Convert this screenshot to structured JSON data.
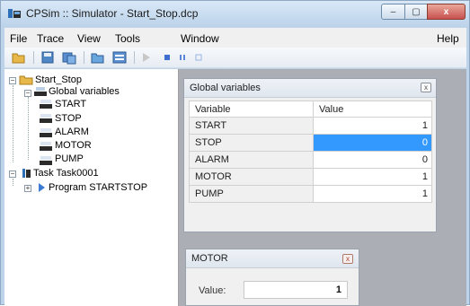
{
  "window": {
    "title": "CPSim :: Simulator - Start_Stop.dcp",
    "controls": {
      "minimize": "–",
      "maximize": "▢",
      "close": "x"
    }
  },
  "menu": {
    "items": [
      "File",
      "Trace",
      "View",
      "Tools",
      "Window"
    ],
    "right": "Help"
  },
  "toolbar": {
    "icons": [
      "open-folder-icon",
      "save-icon",
      "build-icon",
      "new-project-icon",
      "list-icon",
      "run-icon",
      "stop-icon",
      "pause-icon",
      "step-icon"
    ]
  },
  "tree": {
    "project": "Start_Stop",
    "global_vars": "Global variables",
    "variables": [
      "START",
      "STOP",
      "ALARM",
      "MOTOR",
      "PUMP"
    ],
    "task": "Task Task0001",
    "program": "Program STARTSTOP"
  },
  "global_panel": {
    "title": "Global variables",
    "close": "x",
    "columns": [
      "Variable",
      "Value"
    ],
    "rows": [
      {
        "name": "START",
        "value": "1"
      },
      {
        "name": "STOP",
        "value": "0"
      },
      {
        "name": "ALARM",
        "value": "0"
      },
      {
        "name": "MOTOR",
        "value": "1"
      },
      {
        "name": "PUMP",
        "value": "1"
      }
    ],
    "selected_row": "STOP"
  },
  "motor_panel": {
    "title": "MOTOR",
    "close": "x",
    "label": "Value:",
    "value": "1"
  }
}
